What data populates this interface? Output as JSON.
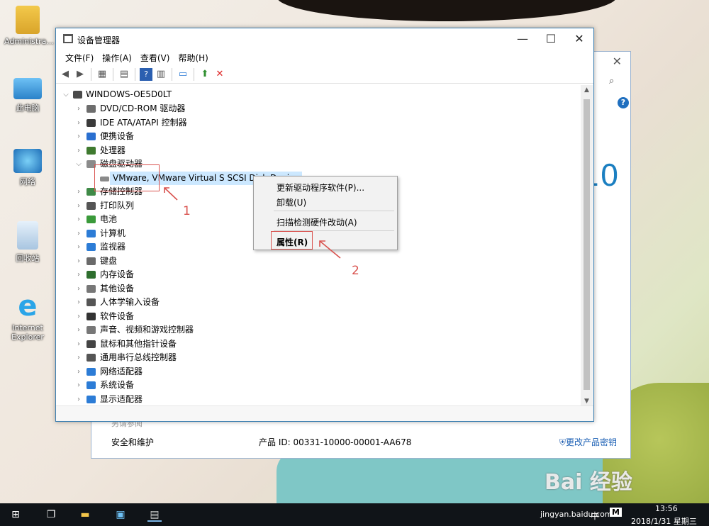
{
  "desktop": {
    "icons": [
      {
        "label": "Administra..."
      },
      {
        "label": "此电脑"
      },
      {
        "label": "网络"
      },
      {
        "label": "回收站"
      },
      {
        "label": "Internet Explorer"
      }
    ]
  },
  "background_window": {
    "big_number": "10",
    "faint_label": "另请参阅",
    "security_label": "安全和维护",
    "product_id": "产品 ID: 00331-10000-00001-AA678",
    "change_key": "更改产品密钥"
  },
  "window": {
    "title": "设备管理器",
    "menu": [
      "文件(F)",
      "操作(A)",
      "查看(V)",
      "帮助(H)"
    ],
    "tree_root": "WINDOWS-OE5D0LT",
    "categories": [
      {
        "label": "DVD/CD-ROM 驱动器",
        "color": "#6d6d6d"
      },
      {
        "label": "IDE ATA/ATAPI 控制器",
        "color": "#3a3a3a"
      },
      {
        "label": "便携设备",
        "color": "#2a6fd0"
      },
      {
        "label": "处理器",
        "color": "#3f7a2f"
      },
      {
        "label": "磁盘驱动器",
        "color": "#8b8b8b",
        "expanded": true
      },
      {
        "label": "存储控制器",
        "color": "#3f8a47"
      },
      {
        "label": "打印队列",
        "color": "#555"
      },
      {
        "label": "电池",
        "color": "#3a9a3a"
      },
      {
        "label": "计算机",
        "color": "#2c7cd6"
      },
      {
        "label": "监视器",
        "color": "#2c7cd6"
      },
      {
        "label": "键盘",
        "color": "#6a6a6a"
      },
      {
        "label": "内存设备",
        "color": "#2e6e2e"
      },
      {
        "label": "其他设备",
        "color": "#777"
      },
      {
        "label": "人体学输入设备",
        "color": "#555"
      },
      {
        "label": "软件设备",
        "color": "#333"
      },
      {
        "label": "声音、视频和游戏控制器",
        "color": "#777"
      },
      {
        "label": "鼠标和其他指针设备",
        "color": "#444"
      },
      {
        "label": "通用串行总线控制器",
        "color": "#555"
      },
      {
        "label": "网络适配器",
        "color": "#2c7cd6"
      },
      {
        "label": "系统设备",
        "color": "#2c7cd6"
      },
      {
        "label": "显示适配器",
        "color": "#2c7cd6"
      }
    ],
    "disk_child": "VMware, VMware Virtual S SCSI Disk Device"
  },
  "context_menu": {
    "update": "更新驱动程序软件(P)...",
    "uninstall": "卸载(U)",
    "scan": "扫描检测硬件改动(A)",
    "properties": "属性(R)"
  },
  "annotations": {
    "step1": "1",
    "step2": "2"
  },
  "taskbar": {
    "tray_text": "jingyan.baidu.com",
    "ime": "中",
    "time": "13:56",
    "date": "2018/1/31 星期三"
  },
  "watermark": "Bai 经验"
}
